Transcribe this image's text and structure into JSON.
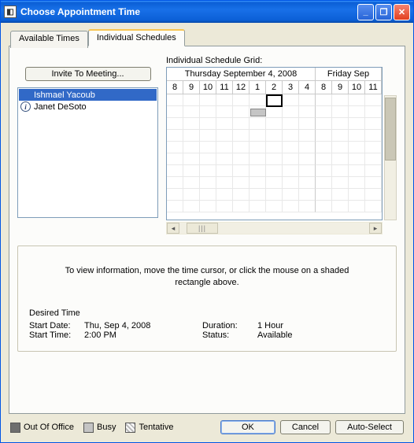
{
  "window": {
    "title": "Choose Appointment Time"
  },
  "tabs": {
    "available": "Available Times",
    "individual": "Individual Schedules"
  },
  "invite_label": "Invite To Meeting...",
  "people": [
    {
      "name": "Ishmael Yacoub",
      "selected": true,
      "has_info": false
    },
    {
      "name": "Janet DeSoto",
      "selected": false,
      "has_info": true
    }
  ],
  "grid_label": "Individual Schedule Grid:",
  "days": {
    "thu": "Thursday September 4, 2008",
    "fri": "Friday Sep"
  },
  "hours": [
    "8",
    "9",
    "10",
    "11",
    "12",
    "1",
    "2",
    "3",
    "4",
    "8",
    "9",
    "10",
    "11"
  ],
  "info_message": "To view information, move the time cursor, or click the mouse on a shaded rectangle above.",
  "desired": {
    "title": "Desired Time",
    "start_date_label": "Start Date:",
    "start_date_value": "Thu, Sep 4, 2008",
    "start_time_label": "Start Time:",
    "start_time_value": "2:00 PM",
    "duration_label": "Duration:",
    "duration_value": "1 Hour",
    "status_label": "Status:",
    "status_value": "Available"
  },
  "legend": {
    "outofoffice": "Out Of Office",
    "busy": "Busy",
    "tentative": "Tentative"
  },
  "buttons": {
    "ok": "OK",
    "cancel": "Cancel",
    "autoselect": "Auto-Select"
  }
}
